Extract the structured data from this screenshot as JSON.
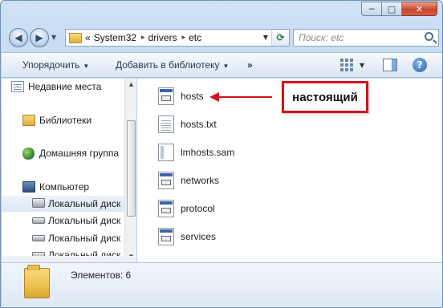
{
  "window": {
    "caption_min": "─",
    "caption_max": "□",
    "caption_close": "✕"
  },
  "address": {
    "overflow": "«",
    "crumbs": [
      "System32",
      "drivers",
      "etc"
    ],
    "separator": "▸"
  },
  "search": {
    "placeholder": "Поиск: etc"
  },
  "toolbar": {
    "organize": "Упорядочить",
    "add_to_library": "Добавить в библиотеку",
    "more": "»",
    "dropdown_glyph": "▼",
    "help": "?"
  },
  "nav_pane": {
    "items": [
      {
        "label": "Недавние места",
        "icon": "recent-places-icon"
      },
      {
        "label": "Библиотеки",
        "icon": "libraries-icon"
      },
      {
        "label": "Домашняя группа",
        "icon": "homegroup-icon"
      },
      {
        "label": "Компьютер",
        "icon": "computer-icon"
      },
      {
        "label": "Локальный диск",
        "icon": "local-disk-system-icon",
        "selected": true
      },
      {
        "label": "Локальный диск",
        "icon": "local-disk-icon"
      },
      {
        "label": "Локальный диск",
        "icon": "local-disk-icon"
      },
      {
        "label": "Локальный диск",
        "icon": "local-disk-icon"
      }
    ]
  },
  "files": [
    {
      "name": "hosts",
      "icon": "system-file-icon"
    },
    {
      "name": "hosts.txt",
      "icon": "text-file-icon"
    },
    {
      "name": "lmhosts.sam",
      "icon": "sam-file-icon"
    },
    {
      "name": "networks",
      "icon": "system-file-icon"
    },
    {
      "name": "protocol",
      "icon": "system-file-icon"
    },
    {
      "name": "services",
      "icon": "system-file-icon"
    }
  ],
  "annotation": {
    "text": "настоящий",
    "color": "#d4121d"
  },
  "status": {
    "items_count": "Элементов: 6"
  }
}
